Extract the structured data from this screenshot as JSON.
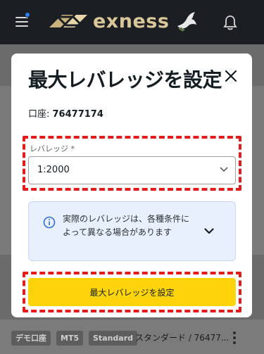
{
  "header": {
    "brand_name": "exness",
    "menu_icon": "hamburger-menu-icon",
    "notification_icon": "bell-icon",
    "accent_color": "#2f7bf0",
    "brand_color": "#d9c79a"
  },
  "background": {
    "tags": [
      "デモ口座",
      "MT5",
      "Standard"
    ],
    "account_text": "スタンダード / 76477..."
  },
  "modal": {
    "title": "最大レバレッジを設定",
    "account_label": "口座: ",
    "account_number": "76477174",
    "leverage_label": "レバレッジ *",
    "leverage_value": "1:2000",
    "info_text": "実際のレバレッジは、各種条件によって異なる場合があります",
    "submit_label": "最大レバレッジを設定",
    "submit_color": "#fdd40a",
    "highlight_color": "#e31b1b"
  }
}
